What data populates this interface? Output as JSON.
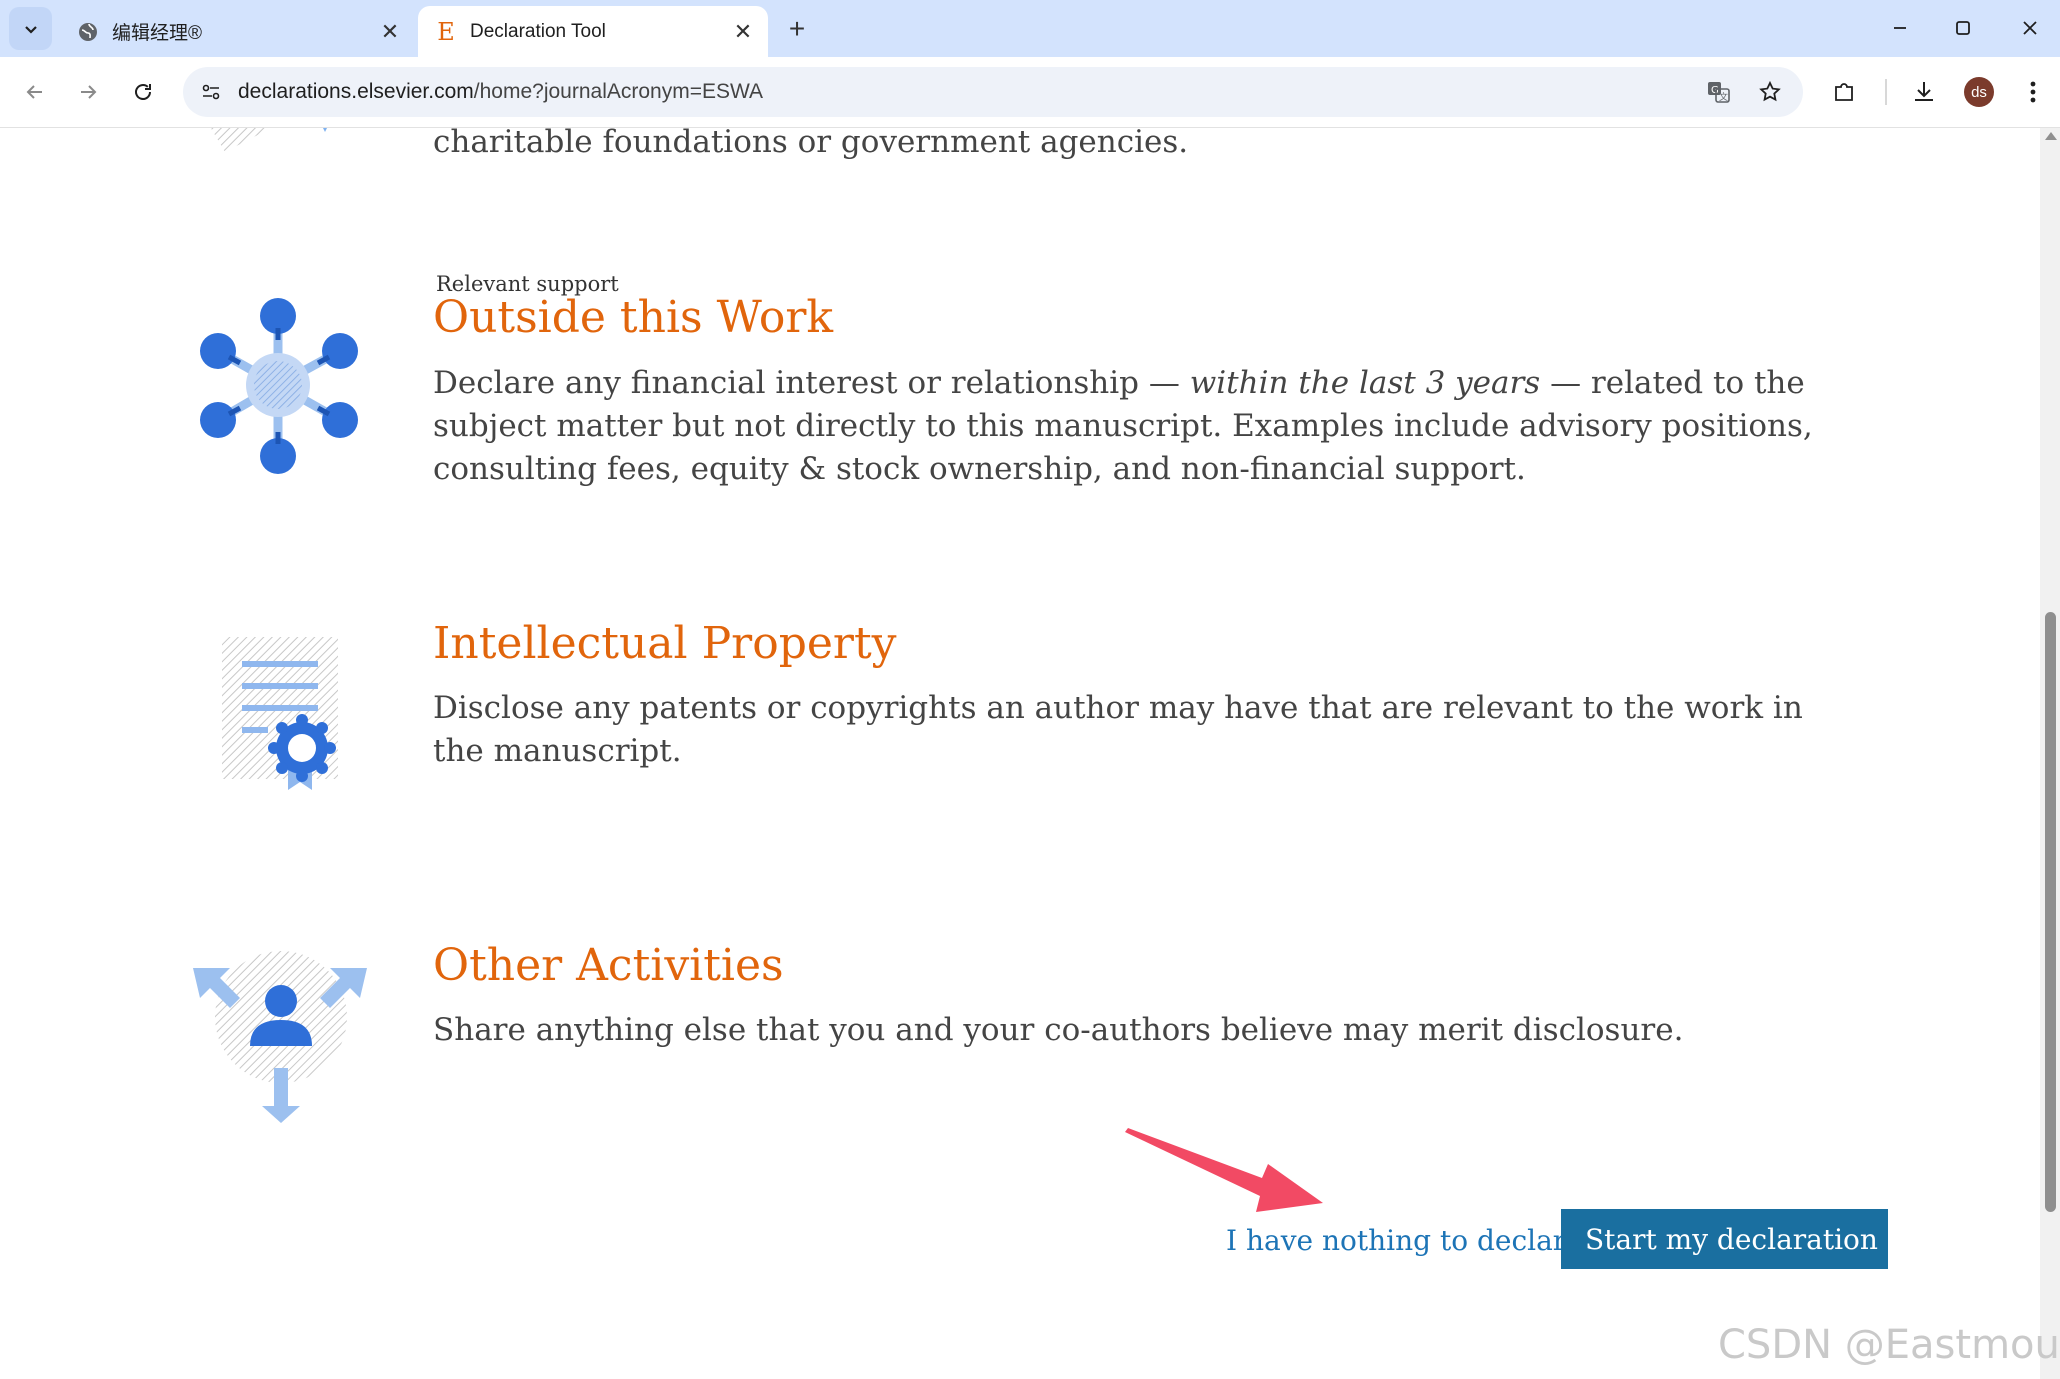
{
  "browser": {
    "tabs": [
      {
        "title": "编辑经理®",
        "active": false
      },
      {
        "title": "Declaration Tool",
        "active": true,
        "favicon_letter": "E"
      }
    ],
    "url_host": "declarations.elsevier.com",
    "url_path": "/home?journalAcronym=ESWA",
    "profile_initials": "ds"
  },
  "sections": {
    "funding_tail": {
      "text": "charitable foundations or government agencies."
    },
    "outside": {
      "kicker": "Relevant support",
      "title": "Outside this Work",
      "text_before": "Declare any financial interest or relationship — ",
      "text_em": "within the last 3 years",
      "text_after": " — related to the subject matter but not directly to this manuscript. Examples include advisory positions, consulting fees, equity & stock ownership, and non-financial support."
    },
    "ip": {
      "title": "Intellectual Property",
      "text": "Disclose any patents or copyrights an author may have that are relevant to the work in the manuscript."
    },
    "other": {
      "title": "Other Activities",
      "text": "Share anything else that you and your co-authors believe may merit disclosure."
    }
  },
  "actions": {
    "nothing_label": "I have nothing to declare.",
    "start_label": "Start my declaration"
  },
  "watermark": "CSDN @Eastmount",
  "colors": {
    "heading": "#e1650c",
    "link": "#1d74b6",
    "button": "#1a6fa0",
    "arrow": "#f24a64"
  }
}
